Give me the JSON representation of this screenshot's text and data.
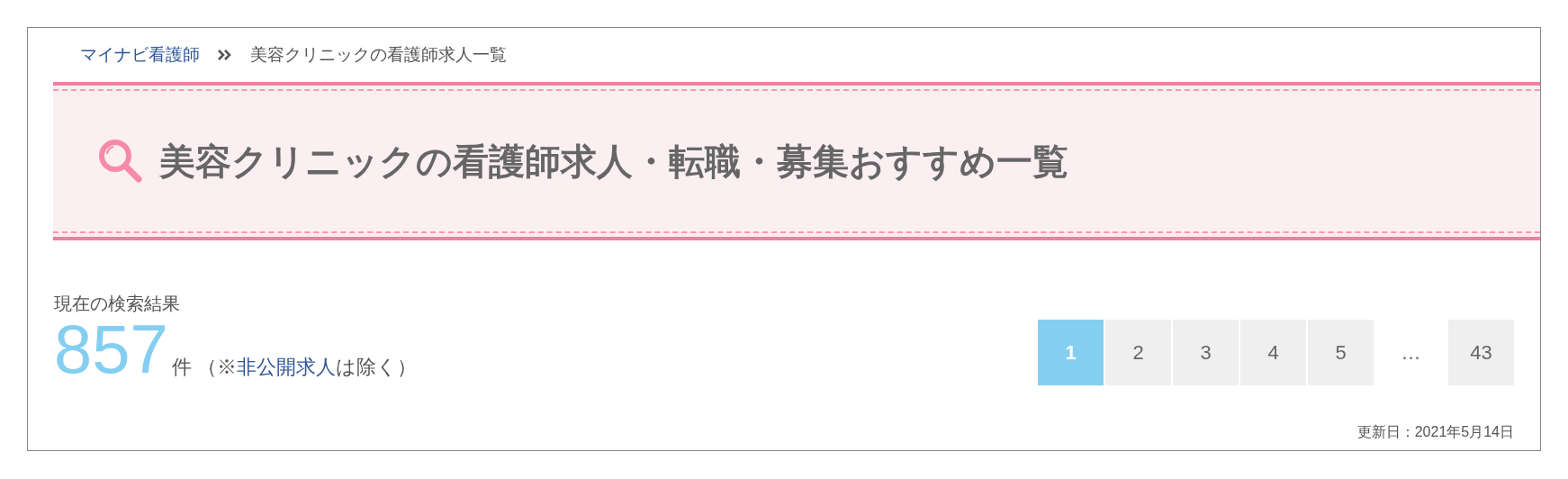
{
  "breadcrumb": [
    {
      "label": "マイナビ看護師",
      "link": true
    },
    {
      "label": "美容クリニックの看護師求人一覧",
      "link": false
    }
  ],
  "heading": "美容クリニックの看護師求人・転職・募集おすすめ一覧",
  "results": {
    "label": "現在の検索結果",
    "count": "857",
    "unit": "件",
    "note_prefix": "（※",
    "note_link": "非公開求人",
    "note_suffix": "は除く）"
  },
  "pagination": [
    {
      "kind": "page",
      "label": "1",
      "selected": true
    },
    {
      "kind": "page",
      "label": "2",
      "selected": false
    },
    {
      "kind": "page",
      "label": "3",
      "selected": false
    },
    {
      "kind": "page",
      "label": "4",
      "selected": false
    },
    {
      "kind": "page",
      "label": "5",
      "selected": false
    },
    {
      "kind": "ellipsis",
      "label": "…"
    },
    {
      "kind": "page",
      "label": "43",
      "selected": false
    }
  ],
  "updated": "更新日：2021年5月14日"
}
